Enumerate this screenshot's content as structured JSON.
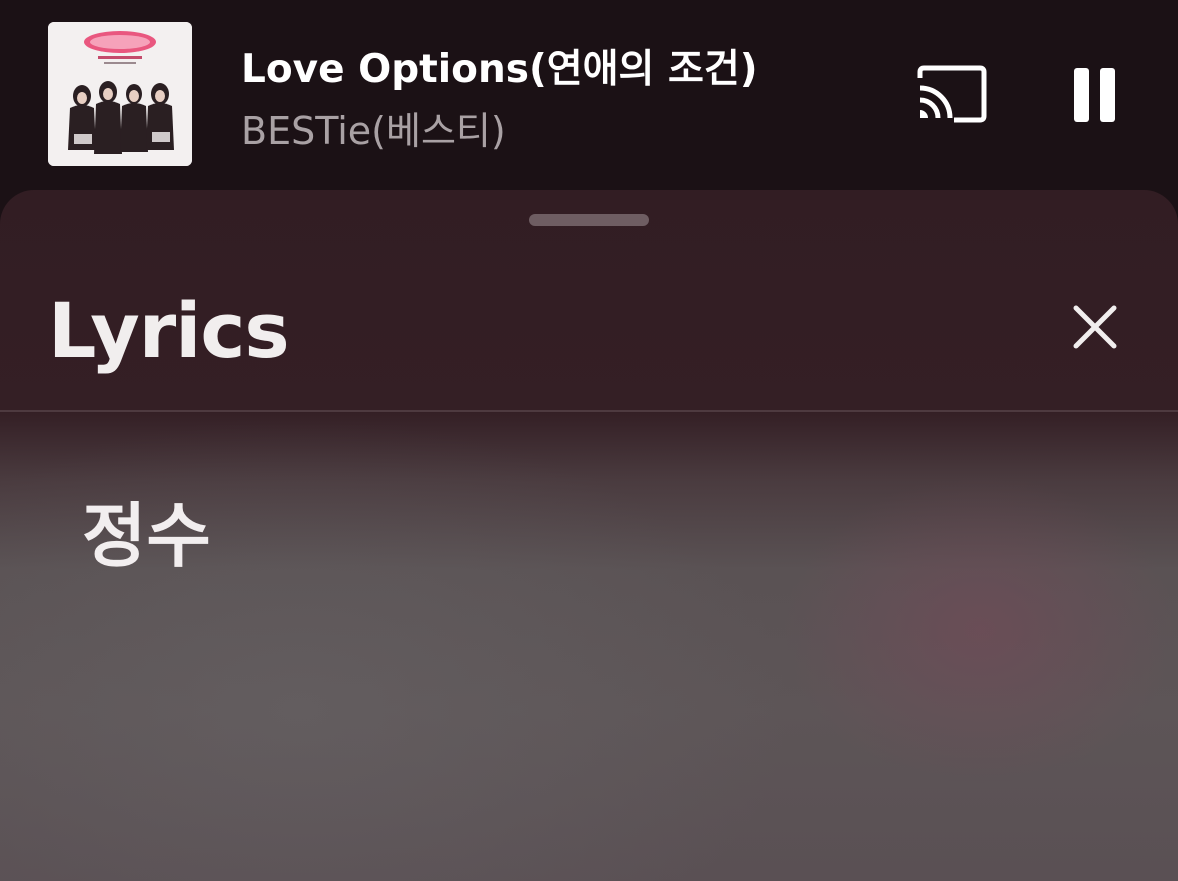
{
  "now_playing": {
    "title": "Love Options(연애의 조건)",
    "artist": "BESTie(베스티)",
    "album_art_icon": "album-cover-image"
  },
  "controls": {
    "cast_icon": "cast-icon",
    "pause_icon": "pause-icon"
  },
  "lyrics_panel": {
    "title": "Lyrics",
    "close_icon": "close-icon",
    "lines": [
      "정수"
    ]
  },
  "colors": {
    "background": "#1b1115",
    "title_text": "#ffffff",
    "artist_text": "#a9a1a4",
    "sheet_top": "#341f25",
    "sheet_body": "#5d5557"
  }
}
